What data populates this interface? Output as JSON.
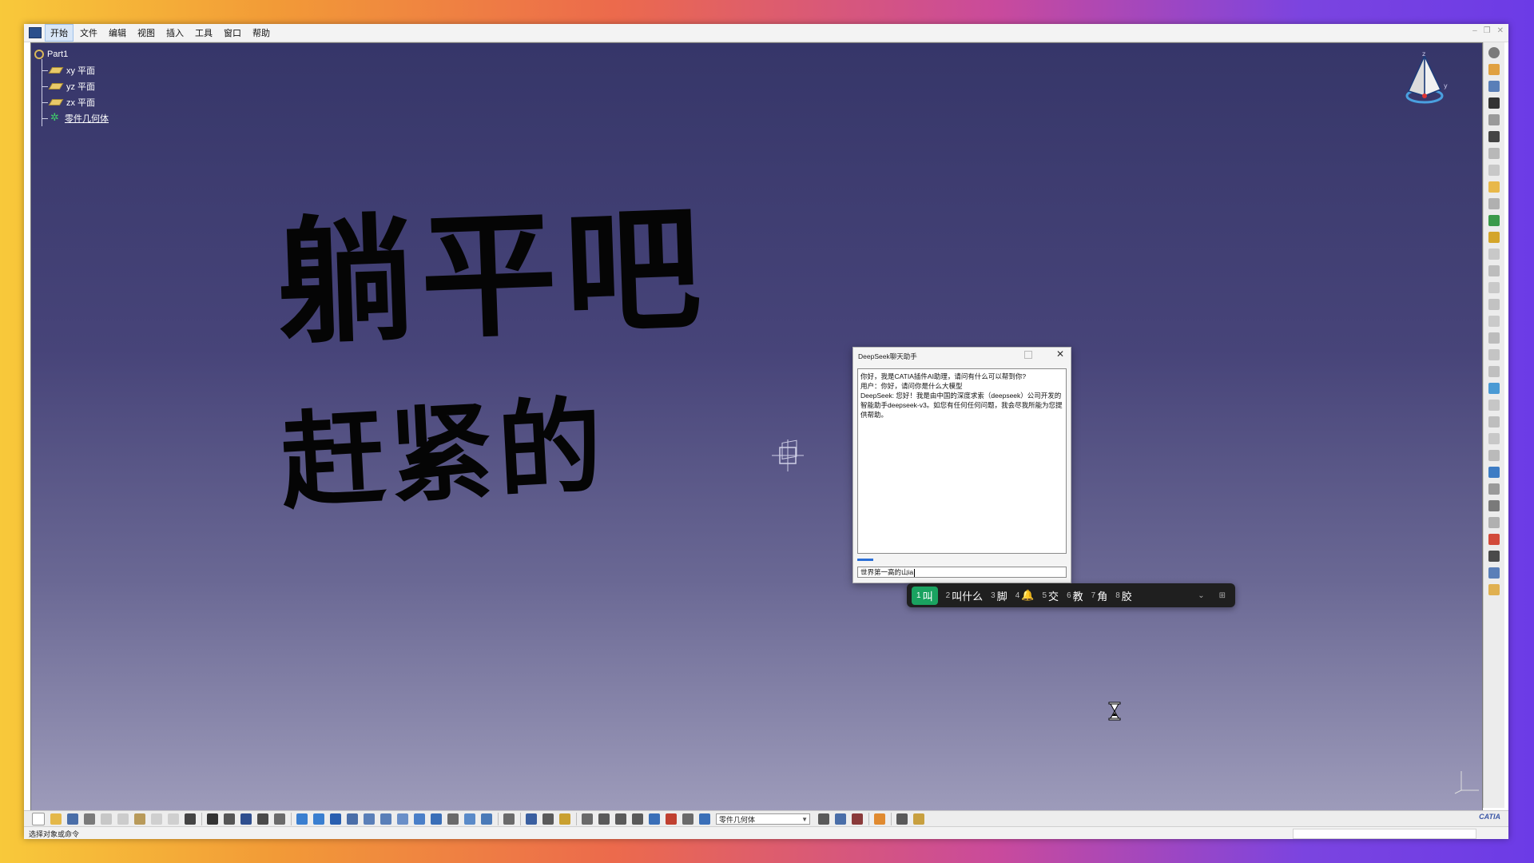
{
  "menubar": {
    "items": [
      "开始",
      "文件",
      "编辑",
      "视图",
      "插入",
      "工具",
      "窗口",
      "帮助"
    ],
    "active_index": 0
  },
  "tree": {
    "root": "Part1",
    "items": [
      {
        "label": "xy 平面",
        "icon": "plane-icon"
      },
      {
        "label": "yz 平面",
        "icon": "plane-icon"
      },
      {
        "label": "zx 平面",
        "icon": "plane-icon"
      },
      {
        "label": "零件几何体",
        "icon": "body-icon"
      }
    ]
  },
  "handwriting": {
    "line1": "躺平吧",
    "line2": "赶紧的",
    "color": "#050505"
  },
  "dialog": {
    "title": "DeepSeek聊天助手",
    "messages": [
      "你好，我是CATIA插件AI助理，请问有什么可以帮到你?",
      "用户：你好，请问你是什么大模型",
      "DeepSeek: 您好！我是由中国的深度求索（deepseek）公司开发的智能助手deepseek-v3。如您有任何任何问题，我会尽我所能为您提供帮助。"
    ],
    "input_value": "世界第一高的山ia"
  },
  "ime": {
    "candidates": [
      {
        "n": "1",
        "text": "叫"
      },
      {
        "n": "2",
        "text": "叫什么"
      },
      {
        "n": "3",
        "text": "脚"
      },
      {
        "n": "4",
        "text": "🔔"
      },
      {
        "n": "5",
        "text": "交"
      },
      {
        "n": "6",
        "text": "教"
      },
      {
        "n": "7",
        "text": "角"
      },
      {
        "n": "8",
        "text": "胶"
      }
    ],
    "selected_index": 0,
    "accent": "#1aa260"
  },
  "toolbar": {
    "part_select": "零件几何体"
  },
  "status": {
    "text": "选择对象或命令"
  },
  "colors": {
    "viewport_top": "#363669",
    "viewport_bottom": "#9d9bba"
  }
}
